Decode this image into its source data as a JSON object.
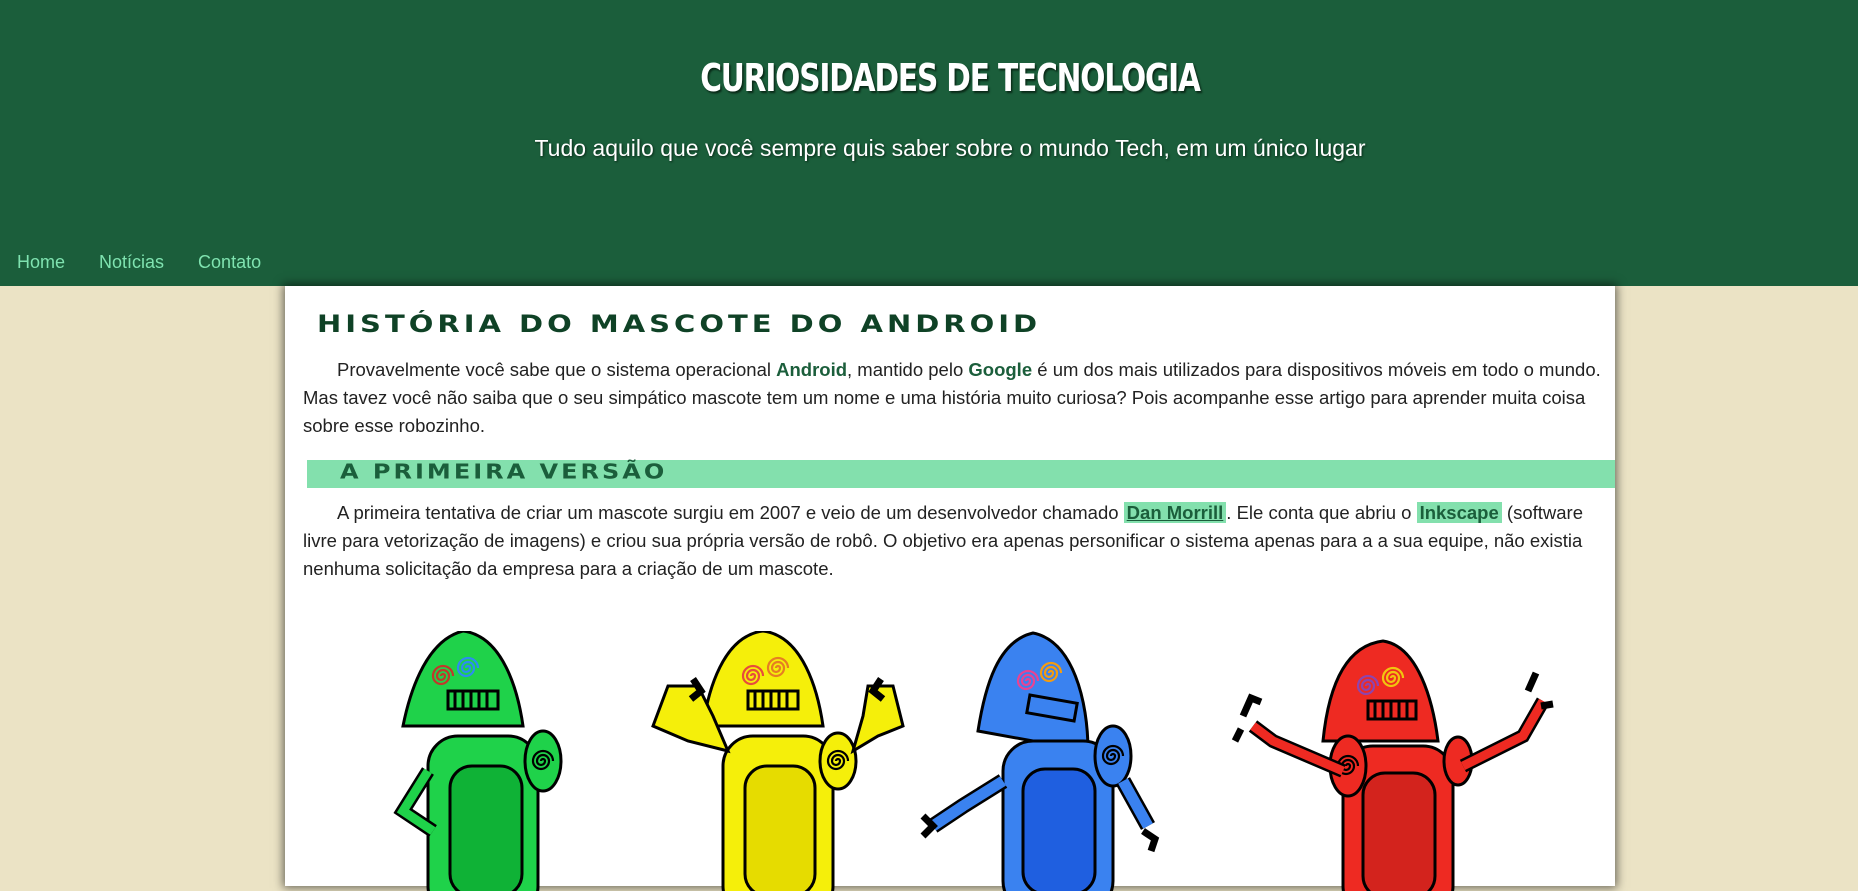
{
  "header": {
    "title": "CURIOSIDADES DE TECNOLOGIA",
    "subtitle": "Tudo aquilo que você sempre quis saber sobre o mundo Tech, em um único lugar"
  },
  "nav": {
    "items": [
      {
        "label": "Home"
      },
      {
        "label": "Notícias"
      },
      {
        "label": "Contato"
      }
    ]
  },
  "article": {
    "title": "História do mascote do Android",
    "intro": {
      "t1": "Provavelmente você sabe que o sistema operacional ",
      "android": "Android",
      "t2": ", mantido pelo ",
      "google": "Google",
      "t3": " é um dos mais utilizados para dispositivos móveis em todo o mundo. Mas tavez você não saiba que o seu simpático mascote tem um nome e uma história muito curiosa? Pois acompanhe esse artigo para aprender muita coisa sobre esse robozinho."
    },
    "section1": {
      "heading": "A primeira versão",
      "t1": "A primeira tentativa de criar um mascote surgiu em 2007 e veio de um desenvolvedor chamado ",
      "dan": "Dan Morrill",
      "t2": ". Ele conta que abriu o ",
      "inkscape": "Inkscape",
      "t3": " (software livre para vetorização de imagens) e criou sua própria versão de robô. O objetivo era apenas personificar o sistema apenas para a a sua equipe, não existia nenhuma solicitação da empresa para a criação de um mascote."
    }
  },
  "colors": {
    "header_bg": "#1b5e3b",
    "page_bg": "#ebe3c5",
    "accent": "#83e0ad",
    "nav_link": "#7fe3b0"
  },
  "robots": [
    {
      "name": "green-robot",
      "color": "#1fd24a"
    },
    {
      "name": "yellow-robot",
      "color": "#f5ef0a"
    },
    {
      "name": "blue-robot",
      "color": "#3a82f0"
    },
    {
      "name": "red-robot",
      "color": "#ee2a22"
    }
  ]
}
